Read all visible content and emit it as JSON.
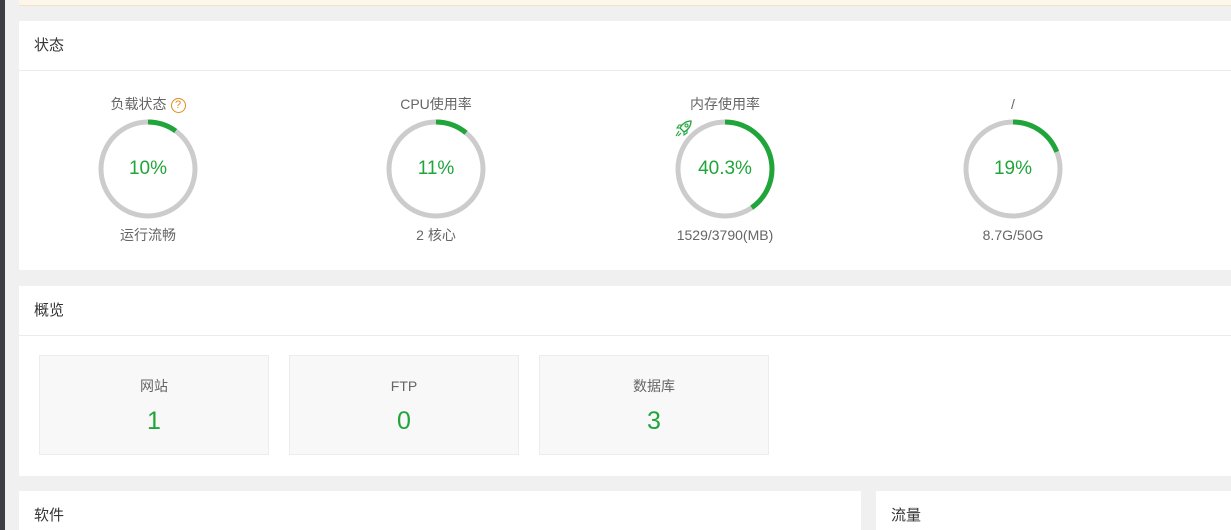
{
  "status": {
    "title": "状态",
    "gauges": [
      {
        "label": "负载状态",
        "value_text": "10%",
        "percent": 10,
        "sub": "运行流畅",
        "has_help": true
      },
      {
        "label": "CPU使用率",
        "value_text": "11%",
        "percent": 11,
        "sub": "2 核心"
      },
      {
        "label": "内存使用率",
        "value_text": "40.3%",
        "percent": 40.3,
        "sub": "1529/3790(MB)",
        "has_rocket": true
      },
      {
        "label": "/",
        "value_text": "19%",
        "percent": 19,
        "sub": "8.7G/50G"
      }
    ],
    "help_glyph": "?"
  },
  "overview": {
    "title": "概览",
    "items": [
      {
        "name": "网站",
        "value": "1"
      },
      {
        "name": "FTP",
        "value": "0"
      },
      {
        "name": "数据库",
        "value": "3"
      }
    ]
  },
  "software": {
    "title": "软件"
  },
  "traffic": {
    "title": "流量"
  },
  "colors": {
    "accent": "#20a53a",
    "ring_track": "#cccccc",
    "help": "#e08b1c"
  }
}
